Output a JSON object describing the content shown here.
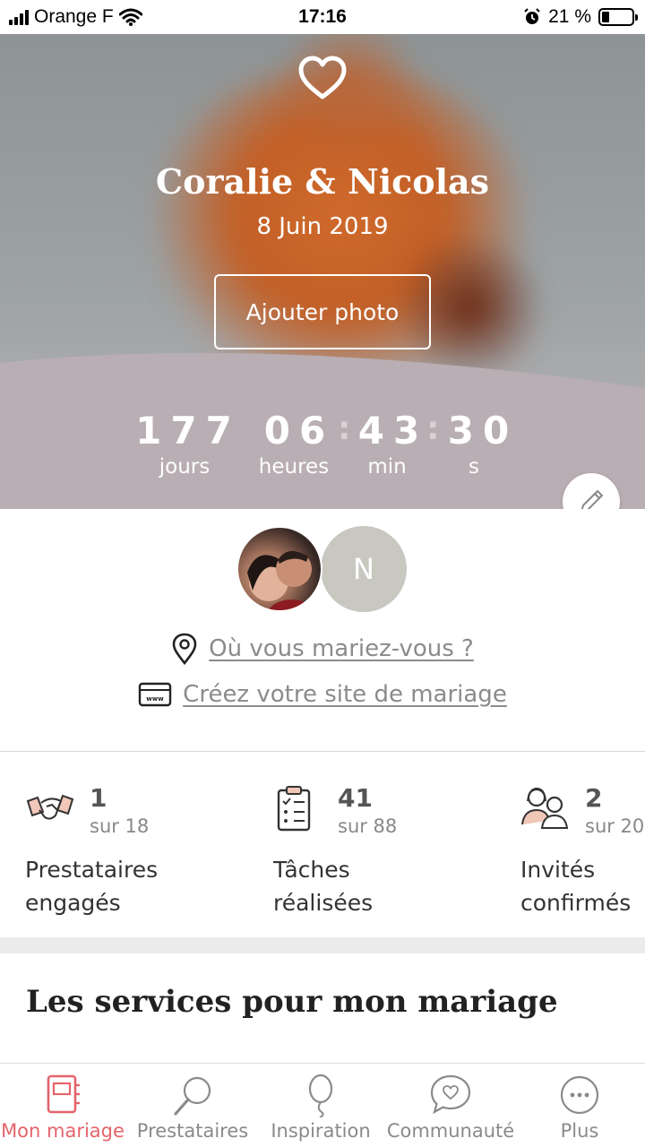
{
  "statusbar": {
    "carrier": "Orange F",
    "time": "17:16",
    "battery": "21 %"
  },
  "hero": {
    "couple": "Coralie & Nicolas",
    "date": "8 Juin 2019",
    "add_photo_label": "Ajouter photo",
    "countdown": {
      "days": "177",
      "days_label": "jours",
      "hours": "06",
      "hours_label": "heures",
      "minutes": "43",
      "minutes_label": "min",
      "seconds": "30",
      "seconds_label": "s",
      "separator": ":"
    }
  },
  "profile": {
    "partner_initial": "N",
    "venue_link": "Où vous mariez-vous ?",
    "site_link": "Créez votre site de mariage"
  },
  "stats": [
    {
      "count": "1",
      "total": "sur 18",
      "label_line1": "Prestataires",
      "label_line2": "engagés",
      "icon": "handshake-icon"
    },
    {
      "count": "41",
      "total": "sur 88",
      "label_line1": "Tâches",
      "label_line2": "réalisées",
      "icon": "checklist-icon"
    },
    {
      "count": "2",
      "total": "sur 20",
      "label_line1": "Invités",
      "label_line2": "confirmés",
      "icon": "guests-icon"
    }
  ],
  "services": {
    "title": "Les services pour mon mariage"
  },
  "tabbar": {
    "items": [
      {
        "label": "Mon mariage",
        "icon": "notebook-icon",
        "active": true
      },
      {
        "label": "Prestataires",
        "icon": "magnifier-icon",
        "active": false
      },
      {
        "label": "Inspiration",
        "icon": "balloon-icon",
        "active": false
      },
      {
        "label": "Communauté",
        "icon": "chat-heart-icon",
        "active": false
      },
      {
        "label": "Plus",
        "icon": "more-icon",
        "active": false
      }
    ]
  },
  "colors": {
    "accent": "#e4646b",
    "hero_band": "#b9aeb3",
    "muted_text": "#8b8b8b"
  }
}
